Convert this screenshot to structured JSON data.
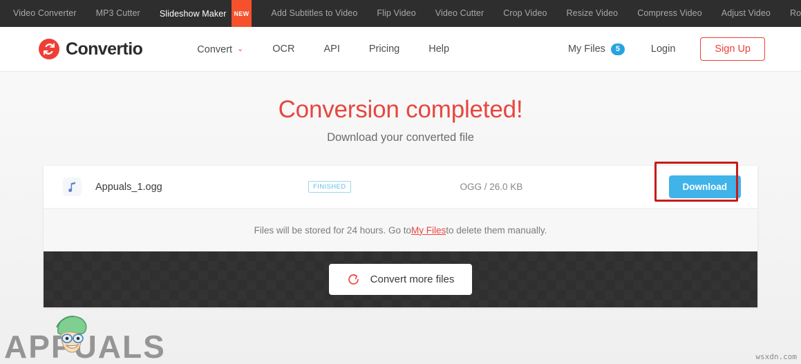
{
  "topnav": {
    "items": [
      {
        "label": "Video Converter",
        "active": false,
        "badge": null
      },
      {
        "label": "MP3 Cutter",
        "active": false,
        "badge": null
      },
      {
        "label": "Slideshow Maker",
        "active": true,
        "badge": "NEW"
      },
      {
        "label": "Add Subtitles to Video",
        "active": false,
        "badge": null
      },
      {
        "label": "Flip Video",
        "active": false,
        "badge": null
      },
      {
        "label": "Video Cutter",
        "active": false,
        "badge": null
      },
      {
        "label": "Crop Video",
        "active": false,
        "badge": null
      },
      {
        "label": "Resize Video",
        "active": false,
        "badge": null
      },
      {
        "label": "Compress Video",
        "active": false,
        "badge": null
      },
      {
        "label": "Adjust Video",
        "active": false,
        "badge": null
      },
      {
        "label": "Rotate Video",
        "active": false,
        "badge": null
      }
    ]
  },
  "header": {
    "brand_name": "Convertio",
    "brand_icon": "convertio-refresh-logo",
    "nav": [
      {
        "label": "Convert",
        "has_caret": true
      },
      {
        "label": "OCR",
        "has_caret": false
      },
      {
        "label": "API",
        "has_caret": false
      },
      {
        "label": "Pricing",
        "has_caret": false
      },
      {
        "label": "Help",
        "has_caret": false
      }
    ],
    "caret_glyph": "⌄",
    "my_files_label": "My Files",
    "my_files_count": "5",
    "login_label": "Login",
    "signup_label": "Sign Up"
  },
  "hero": {
    "title": "Conversion completed!",
    "subtitle": "Download your converted file"
  },
  "file_row": {
    "icon": "music-note-icon",
    "icon_glyph": "♪",
    "name": "Appuals_1.ogg",
    "status": "FINISHED",
    "meta": "OGG / 26.0 KB",
    "download_label": "Download"
  },
  "notice": {
    "text_before": "Files will be stored for 24 hours. Go to ",
    "link_label": "My Files",
    "text_after": " to delete them manually."
  },
  "footer": {
    "convert_more_label": "Convert more files",
    "refresh_icon": "refresh-arrow-icon"
  },
  "watermark": {
    "text": "APPUALS",
    "corner_tag": "wsxdn.com"
  },
  "colors": {
    "brand_red": "#ef3e36",
    "hero_red": "#e8463f",
    "accent_blue": "#40b3e8",
    "badge_blue": "#29a3e0",
    "status_blue": "#62bfe5",
    "highlight_red": "#c91a1a",
    "topnav_bg": "#2e2e2e",
    "footer_bg": "#333333",
    "new_badge": "#f4512c"
  }
}
